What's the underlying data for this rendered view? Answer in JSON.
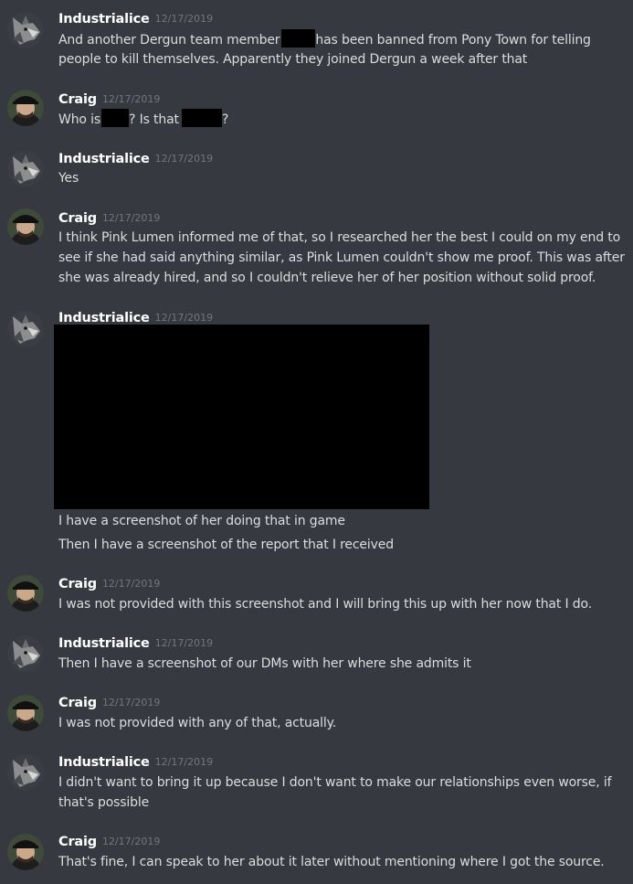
{
  "users": {
    "industrialice": "Industrialice",
    "craig": "Craig"
  },
  "messages": [
    {
      "author": "Industrialice",
      "timestamp": "12/17/2019",
      "lines": [
        {
          "a": "And another Dergun team member",
          "b": "has been banned from Pony Town for telling"
        },
        {
          "a": "people to kill themselves. Apparently they joined Dergun a week after that"
        }
      ]
    },
    {
      "author": "Craig",
      "timestamp": "12/17/2019",
      "lines": [
        {
          "a": "Who is",
          "b": "? Is that",
          "c": "?"
        }
      ]
    },
    {
      "author": "Industrialice",
      "timestamp": "12/17/2019",
      "lines": [
        {
          "a": "Yes"
        }
      ]
    },
    {
      "author": "Craig",
      "timestamp": "12/17/2019",
      "lines": [
        {
          "a": "I think Pink Lumen informed me of that, so I researched her the best I could on my end to"
        },
        {
          "a": "see if she had said anything similar, as Pink Lumen couldn't show me proof. This was after"
        },
        {
          "a": "she was already hired, and so I couldn't relieve her of her position without solid proof."
        }
      ]
    },
    {
      "author": "Industrialice",
      "timestamp": "12/17/2019",
      "lines": [
        {
          "a": "I have a screenshot of her doing that in game"
        },
        {
          "a": "Then I have a screenshot of the report that I received"
        }
      ]
    },
    {
      "author": "Craig",
      "timestamp": "12/17/2019",
      "lines": [
        {
          "a": "I was not provided with this screenshot and I will bring this up with her now that I do."
        }
      ]
    },
    {
      "author": "Industrialice",
      "timestamp": "12/17/2019",
      "lines": [
        {
          "a": "Then I have a screenshot of our DMs with her where she admits it"
        }
      ]
    },
    {
      "author": "Craig",
      "timestamp": "12/17/2019",
      "lines": [
        {
          "a": "I was not provided with any of that, actually."
        }
      ]
    },
    {
      "author": "Industrialice",
      "timestamp": "12/17/2019",
      "lines": [
        {
          "a": "I didn't want to bring it up because I don't want to make our relationships even worse, if"
        },
        {
          "a": "that's possible"
        }
      ]
    },
    {
      "author": "Craig",
      "timestamp": "12/17/2019",
      "lines": [
        {
          "a": "That's fine, I can speak to her about it later without mentioning where I got the source."
        }
      ]
    }
  ],
  "colors": {
    "background": "#36393f",
    "username": "#ffffff",
    "timestamp": "#72767d",
    "text": "#dcddde",
    "redaction": "#000000"
  }
}
